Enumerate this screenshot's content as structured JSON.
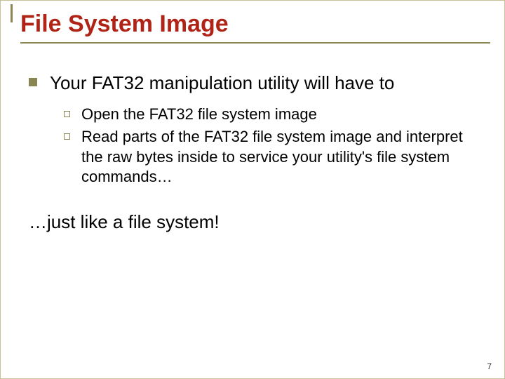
{
  "title": "File System Image",
  "main_point": "Your FAT32 manipulation utility will have to",
  "subpoints": [
    "Open the FAT32 file system image",
    "Read parts of the FAT32 file system image and interpret the raw bytes inside to service your utility's file system commands…"
  ],
  "closing": "…just like a file system!",
  "page_number": "7"
}
